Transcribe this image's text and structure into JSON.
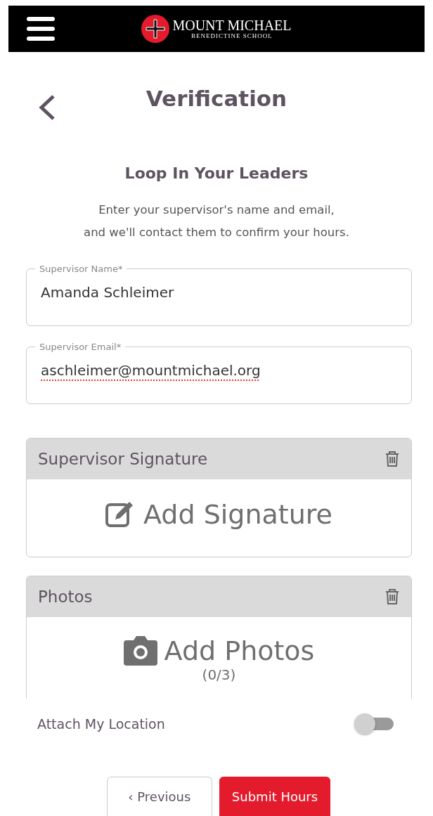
{
  "header": {
    "logo_title": "MOUNT MICHAEL",
    "logo_subtitle": "BENEDICTINE SCHOOL"
  },
  "page": {
    "title": "Verification"
  },
  "section": {
    "heading": "Loop In Your Leaders",
    "description": "Enter your supervisor's name and email,\nand we'll contact them to confirm your hours."
  },
  "fields": [
    {
      "label": "Supervisor Name*",
      "value": "Amanda Schleimer",
      "spellcheck_error": false
    },
    {
      "label": "Supervisor Email*",
      "value": "aschleimer@mountmichael.org",
      "spellcheck_error": true
    }
  ],
  "cards": [
    {
      "kind": "signature",
      "title": "Supervisor Signature",
      "action": "Add Signature"
    },
    {
      "kind": "photos",
      "title": "Photos",
      "action": "Add Photos",
      "count": "(0/3)"
    }
  ],
  "location": {
    "label": "Attach My Location",
    "on": false
  },
  "buttons": [
    {
      "kind": "secondary",
      "label": "‹ Previous"
    },
    {
      "kind": "primary",
      "label": "Submit Hours"
    }
  ]
}
